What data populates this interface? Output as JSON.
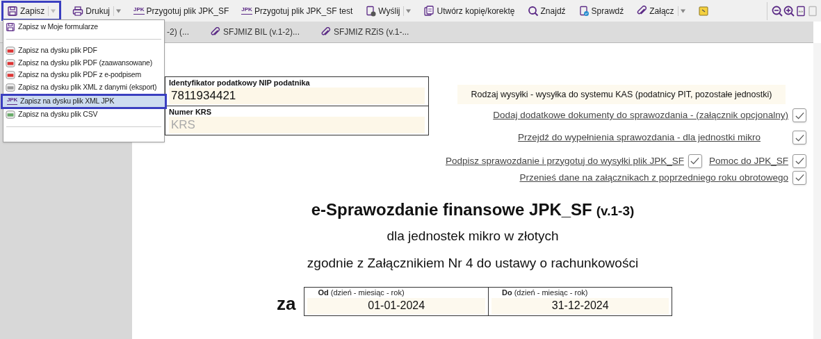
{
  "toolbar": {
    "items": [
      {
        "label": "Zapisz",
        "kind": "save",
        "has_menu": true,
        "selected": true
      },
      {
        "label": "Drukuj",
        "kind": "print",
        "has_menu": true,
        "selected": false
      },
      {
        "label": "Przygotuj plik JPK_SF",
        "kind": "jpk",
        "badge": "JPK",
        "has_menu": false,
        "selected": false
      },
      {
        "label": "Przygotuj plik JPK_SF test",
        "kind": "jpk",
        "badge": "JPK",
        "has_menu": false,
        "selected": false
      },
      {
        "label": "Wyślij",
        "kind": "send",
        "has_menu": true,
        "selected": false
      },
      {
        "label": "Utwórz kopię/korektę",
        "kind": "copy",
        "has_menu": false,
        "selected": false
      },
      {
        "label": "Znajdź",
        "kind": "find",
        "has_menu": false,
        "selected": false
      },
      {
        "label": "Sprawdź",
        "kind": "check",
        "has_menu": false,
        "selected": false
      },
      {
        "label": "Załącz",
        "kind": "attach",
        "has_menu": true,
        "selected": false
      },
      {
        "kind": "note",
        "has_menu": false,
        "selected": false
      }
    ]
  },
  "tabs": [
    {
      "label": "-2) (..."
    },
    {
      "label": "SFJMIZ BIL (v.1-2)..."
    },
    {
      "label": "SFJMIZ RZiS (v.1-..."
    }
  ],
  "save_menu": {
    "items": [
      {
        "label": "Zapisz w Moje formularze",
        "kind": "save",
        "selected": false,
        "separator_after": true
      },
      {
        "label": "Zapisz na dysku plik PDF",
        "kind": "pdf",
        "selected": false,
        "separator_after": false
      },
      {
        "label": "Zapisz na dysku plik PDF (zaawansowane)",
        "kind": "pdf",
        "selected": false,
        "separator_after": false
      },
      {
        "label": "Zapisz na dysku plik PDF z e-podpisem",
        "kind": "pdf",
        "selected": false,
        "separator_after": false
      },
      {
        "label": "Zapisz na dysku plik XML z danymi (eksport)",
        "kind": "xml",
        "selected": false,
        "separator_after": false
      },
      {
        "label": "Zapisz na dysku plik XML JPK",
        "kind": "jpk",
        "badge": "JPK",
        "selected": true,
        "separator_after": false
      },
      {
        "label": "Zapisz na dysku plik CSV",
        "kind": "xls",
        "selected": false,
        "separator_after": true
      }
    ]
  },
  "form": {
    "fields": [
      {
        "label": "Identyfikator podatkowy NIP podatnika",
        "value": "7811934421"
      },
      {
        "label": "Numer KRS",
        "placeholder": "KRS"
      }
    ],
    "submission_type": "Rodzaj wysyłki - wysyłka do systemu KAS (podatnicy PIT, pozostałe jednostki)",
    "action_rows": [
      [
        {
          "label": "Dodaj dodatkowe dokumenty do sprawozdania - (załącznik opcjonalny)",
          "checked": true
        }
      ],
      [
        {
          "label": "Przejdź do wypełnienia sprawozdania - dla jednostki mikro",
          "checked": true
        }
      ],
      [
        {
          "label": "Podpisz sprawozdanie i przygotuj do wysyłki plik JPK_SF",
          "checked": true
        },
        {
          "label": "Pomoc do JPK_SF",
          "checked": true
        }
      ],
      [
        {
          "label": "Przenieś dane na załącznikach z poprzedniego roku obrotowego",
          "checked": true
        }
      ]
    ],
    "title": "e-Sprawozdanie finansowe JPK_SF",
    "version": "(v.1-3)",
    "subtitles": [
      "dla jednostek mikro w złotych",
      "zgodnie z Załącznikiem Nr 4 do ustawy o rachunkowości"
    ],
    "period_label": "za",
    "period": [
      {
        "label": "**Od** (dzień - miesiąc - rok)",
        "value": "01-01-2024"
      },
      {
        "label": "**Do** (dzień - miesiąc - rok)",
        "value": "31-12-2024"
      }
    ]
  }
}
